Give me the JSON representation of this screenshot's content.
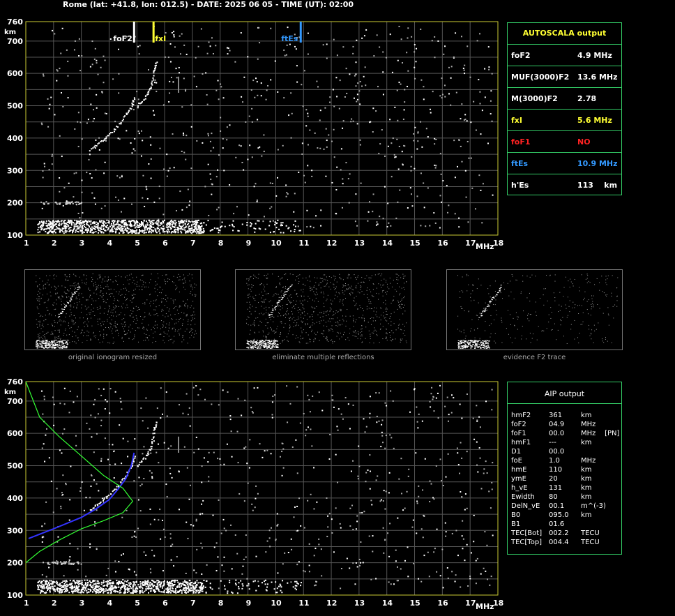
{
  "header": {
    "title": "Rome (lat: +41.8, lon: 012.5) - DATE: 2025 06 05 - TIME (UT): 02:00"
  },
  "chart_data": [
    {
      "type": "scatter",
      "name": "main-ionogram",
      "xlabel": "MHz",
      "ylabel": "km",
      "xlim": [
        1,
        18
      ],
      "ylim": [
        100,
        760
      ],
      "x_ticks": [
        "1",
        "2",
        "3",
        "4",
        "5",
        "6",
        "7",
        "8",
        "9",
        "10",
        "11",
        "12",
        "13",
        "14",
        "15",
        "16",
        "17",
        "18"
      ],
      "y_ticks": [
        "100",
        "200",
        "300",
        "400",
        "500",
        "600",
        "700",
        "760"
      ],
      "grid": true,
      "markers": [
        {
          "label": "foF2",
          "x": 4.9,
          "color": "#ffffff"
        },
        {
          "label": "fxI",
          "x": 5.6,
          "color": "#ffff33"
        },
        {
          "label": "ftEs",
          "x": 10.9,
          "color": "#3399ff"
        }
      ],
      "traces": {
        "es_layer": {
          "x_range": [
            1.5,
            10.9
          ],
          "height_km": [
            113,
            140
          ]
        },
        "f2_o_trace": [
          [
            3.3,
            365
          ],
          [
            3.7,
            390
          ],
          [
            4.1,
            420
          ],
          [
            4.5,
            460
          ],
          [
            4.8,
            500
          ],
          [
            4.9,
            530
          ]
        ],
        "f2_x_trace": [
          [
            5.0,
            500
          ],
          [
            5.3,
            530
          ],
          [
            5.5,
            560
          ],
          [
            5.6,
            610
          ],
          [
            5.7,
            640
          ]
        ]
      }
    },
    {
      "type": "scatter",
      "name": "aip-ionogram",
      "xlabel": "MHz",
      "ylabel": "km",
      "xlim": [
        1,
        18
      ],
      "ylim": [
        100,
        760
      ],
      "x_ticks": [
        "1",
        "2",
        "3",
        "4",
        "5",
        "6",
        "7",
        "8",
        "9",
        "10",
        "11",
        "12",
        "13",
        "14",
        "15",
        "16",
        "17",
        "18"
      ],
      "y_ticks": [
        "100",
        "200",
        "300",
        "400",
        "500",
        "600",
        "700",
        "760"
      ],
      "grid": true,
      "series": [
        {
          "color": "#3333ff",
          "points": [
            [
              1.1,
              275
            ],
            [
              2.0,
              305
            ],
            [
              3.0,
              340
            ],
            [
              3.5,
              365
            ],
            [
              4.0,
              395
            ],
            [
              4.3,
              425
            ],
            [
              4.6,
              460
            ],
            [
              4.8,
              500
            ],
            [
              4.9,
              540
            ]
          ]
        },
        {
          "color": "#33ff33",
          "points": [
            [
              1.0,
              760
            ],
            [
              1.5,
              650
            ],
            [
              2.2,
              590
            ],
            [
              3.0,
              530
            ],
            [
              3.8,
              470
            ],
            [
              4.5,
              430
            ],
            [
              4.85,
              390
            ],
            [
              4.5,
              355
            ],
            [
              3.8,
              330
            ],
            [
              3.0,
              305
            ],
            [
              2.2,
              270
            ],
            [
              1.5,
              235
            ],
            [
              1.0,
              200
            ]
          ]
        }
      ]
    }
  ],
  "autoscala": {
    "title": "AUTOSCALA output",
    "rows": [
      {
        "name": "foF2",
        "value": "4.9 MHz",
        "color": "#ffffff"
      },
      {
        "name": "MUF(3000)F2",
        "value": "13.6 MHz",
        "color": "#ffffff"
      },
      {
        "name": "M(3000)F2",
        "value": "2.78",
        "color": "#ffffff"
      },
      {
        "name": "fxI",
        "value": "5.6 MHz",
        "color": "#ffff33"
      },
      {
        "name": "foF1",
        "value": "NO",
        "color": "#ff2222"
      },
      {
        "name": "ftEs",
        "value": "10.9 MHz",
        "color": "#3399ff"
      },
      {
        "name": "h'Es",
        "value": "113    km",
        "color": "#ffffff"
      }
    ]
  },
  "thumbnails": [
    {
      "caption": "original ionogram resized"
    },
    {
      "caption": "eliminate multiple reflections"
    },
    {
      "caption": "evidence F2 trace"
    }
  ],
  "aip": {
    "title": "AIP output",
    "rows": [
      {
        "name": "hmF2",
        "value": "361",
        "unit": "km"
      },
      {
        "name": "foF2",
        "value": "04.9",
        "unit": "MHz"
      },
      {
        "name": "foF1",
        "value": "00.0",
        "unit": "MHz    [PN]"
      },
      {
        "name": "hmF1",
        "value": "---",
        "unit": "km"
      },
      {
        "name": "D1",
        "value": "00.0",
        "unit": ""
      },
      {
        "name": "foE",
        "value": "1.0",
        "unit": "MHz"
      },
      {
        "name": "hmE",
        "value": "110",
        "unit": "km"
      },
      {
        "name": "ymE",
        "value": "20",
        "unit": "km"
      },
      {
        "name": "h_vE",
        "value": "131",
        "unit": "km"
      },
      {
        "name": "Ewidth",
        "value": "80",
        "unit": "km"
      },
      {
        "name": "DelN_vE",
        "value": "00.1",
        "unit": "m^(-3)"
      },
      {
        "name": "B0",
        "value": "095.0",
        "unit": "km"
      },
      {
        "name": "B1",
        "value": "01.6",
        "unit": ""
      },
      {
        "name": "TEC[Bot]",
        "value": "002.2",
        "unit": "TECU"
      },
      {
        "name": "TEC[Top]",
        "value": "004.4",
        "unit": "TECU"
      }
    ]
  }
}
